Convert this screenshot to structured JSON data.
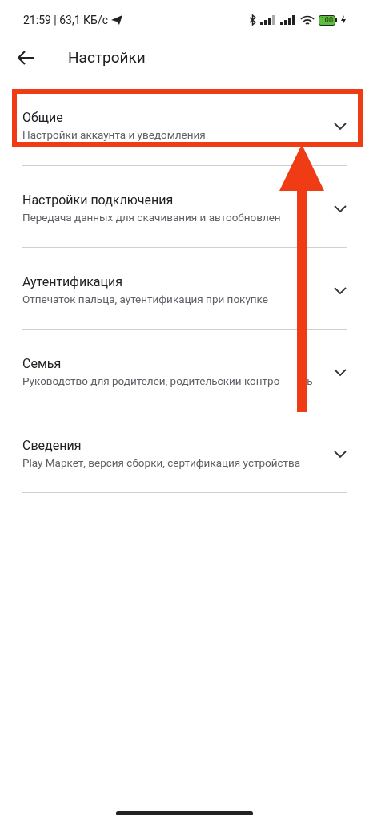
{
  "status_bar": {
    "time": "21:59 | 63,1 КБ/с",
    "battery": "100"
  },
  "header": {
    "title": "Настройки"
  },
  "items": [
    {
      "title": "Общие",
      "subtitle": "Настройки аккаунта и уведомления",
      "expanded": false,
      "highlighted": true
    },
    {
      "title": "Настройки подключения",
      "subtitle": "Передача данных для скачивания и автообновлен",
      "expanded": false,
      "highlighted": false
    },
    {
      "title": "Аутентификация",
      "subtitle": "Отпечаток пальца, аутентификация при покупке",
      "expanded": false,
      "highlighted": false
    },
    {
      "title": "Семья",
      "subtitle": "Руководство для родителей, родительский контро",
      "subtitle_tail": "ь",
      "expanded": false,
      "highlighted": false
    },
    {
      "title": "Сведения",
      "subtitle": "Play Маркет, версия сборки, сертификация устройства",
      "expanded": false,
      "highlighted": false
    }
  ]
}
